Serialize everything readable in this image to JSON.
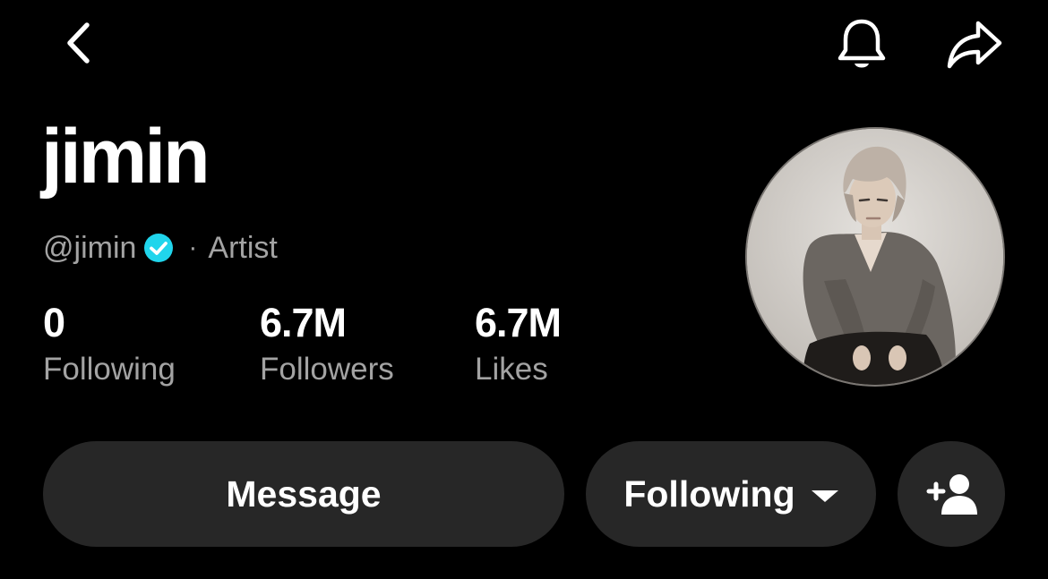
{
  "header": {
    "back_icon": "chevron-left-icon",
    "bell_icon": "bell-icon",
    "share_icon": "share-arrow-icon"
  },
  "profile": {
    "display_name": "jimin",
    "handle": "@jimin",
    "verified_color": "#20d5ec",
    "category": "Artist",
    "separator": "·"
  },
  "stats": [
    {
      "value": "0",
      "label": "Following"
    },
    {
      "value": "6.7M",
      "label": "Followers"
    },
    {
      "value": "6.7M",
      "label": "Likes"
    }
  ],
  "actions": {
    "message_label": "Message",
    "following_label": "Following",
    "add_friend_icon": "add-user-icon"
  }
}
